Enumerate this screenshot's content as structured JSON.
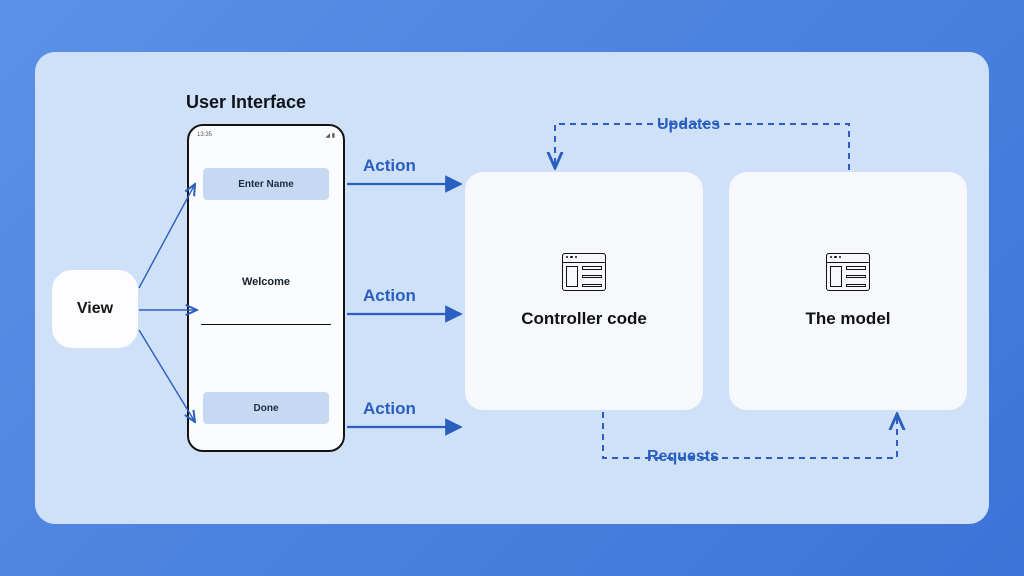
{
  "view": {
    "label": "View"
  },
  "phone": {
    "title": "User Interface",
    "time": "13:35",
    "enter_name": "Enter Name",
    "welcome": "Welcome",
    "done": "Done"
  },
  "actions": {
    "a1": "Action",
    "a2": "Action",
    "a3": "Action"
  },
  "controller": {
    "label": "Controller code"
  },
  "model": {
    "label": "The model"
  },
  "flows": {
    "updates": "Updates",
    "requests": "Requests"
  },
  "colors": {
    "arrow": "#2a5fbf"
  }
}
